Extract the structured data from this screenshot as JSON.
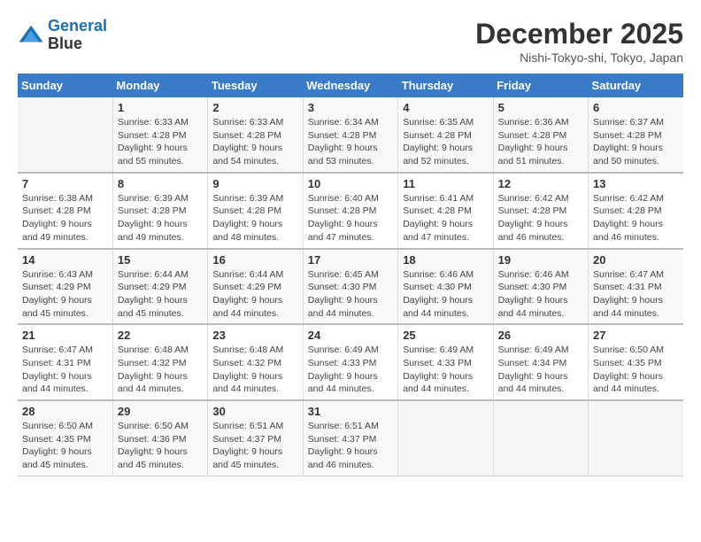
{
  "logo": {
    "line1": "General",
    "line2": "Blue"
  },
  "title": "December 2025",
  "subtitle": "Nishi-Tokyo-shi, Tokyo, Japan",
  "weekdays": [
    "Sunday",
    "Monday",
    "Tuesday",
    "Wednesday",
    "Thursday",
    "Friday",
    "Saturday"
  ],
  "weeks": [
    [
      {
        "day": "",
        "sunrise": "",
        "sunset": "",
        "daylight": ""
      },
      {
        "day": "1",
        "sunrise": "Sunrise: 6:33 AM",
        "sunset": "Sunset: 4:28 PM",
        "daylight": "Daylight: 9 hours and 55 minutes."
      },
      {
        "day": "2",
        "sunrise": "Sunrise: 6:33 AM",
        "sunset": "Sunset: 4:28 PM",
        "daylight": "Daylight: 9 hours and 54 minutes."
      },
      {
        "day": "3",
        "sunrise": "Sunrise: 6:34 AM",
        "sunset": "Sunset: 4:28 PM",
        "daylight": "Daylight: 9 hours and 53 minutes."
      },
      {
        "day": "4",
        "sunrise": "Sunrise: 6:35 AM",
        "sunset": "Sunset: 4:28 PM",
        "daylight": "Daylight: 9 hours and 52 minutes."
      },
      {
        "day": "5",
        "sunrise": "Sunrise: 6:36 AM",
        "sunset": "Sunset: 4:28 PM",
        "daylight": "Daylight: 9 hours and 51 minutes."
      },
      {
        "day": "6",
        "sunrise": "Sunrise: 6:37 AM",
        "sunset": "Sunset: 4:28 PM",
        "daylight": "Daylight: 9 hours and 50 minutes."
      }
    ],
    [
      {
        "day": "7",
        "sunrise": "Sunrise: 6:38 AM",
        "sunset": "Sunset: 4:28 PM",
        "daylight": "Daylight: 9 hours and 49 minutes."
      },
      {
        "day": "8",
        "sunrise": "Sunrise: 6:39 AM",
        "sunset": "Sunset: 4:28 PM",
        "daylight": "Daylight: 9 hours and 49 minutes."
      },
      {
        "day": "9",
        "sunrise": "Sunrise: 6:39 AM",
        "sunset": "Sunset: 4:28 PM",
        "daylight": "Daylight: 9 hours and 48 minutes."
      },
      {
        "day": "10",
        "sunrise": "Sunrise: 6:40 AM",
        "sunset": "Sunset: 4:28 PM",
        "daylight": "Daylight: 9 hours and 47 minutes."
      },
      {
        "day": "11",
        "sunrise": "Sunrise: 6:41 AM",
        "sunset": "Sunset: 4:28 PM",
        "daylight": "Daylight: 9 hours and 47 minutes."
      },
      {
        "day": "12",
        "sunrise": "Sunrise: 6:42 AM",
        "sunset": "Sunset: 4:28 PM",
        "daylight": "Daylight: 9 hours and 46 minutes."
      },
      {
        "day": "13",
        "sunrise": "Sunrise: 6:42 AM",
        "sunset": "Sunset: 4:28 PM",
        "daylight": "Daylight: 9 hours and 46 minutes."
      }
    ],
    [
      {
        "day": "14",
        "sunrise": "Sunrise: 6:43 AM",
        "sunset": "Sunset: 4:29 PM",
        "daylight": "Daylight: 9 hours and 45 minutes."
      },
      {
        "day": "15",
        "sunrise": "Sunrise: 6:44 AM",
        "sunset": "Sunset: 4:29 PM",
        "daylight": "Daylight: 9 hours and 45 minutes."
      },
      {
        "day": "16",
        "sunrise": "Sunrise: 6:44 AM",
        "sunset": "Sunset: 4:29 PM",
        "daylight": "Daylight: 9 hours and 44 minutes."
      },
      {
        "day": "17",
        "sunrise": "Sunrise: 6:45 AM",
        "sunset": "Sunset: 4:30 PM",
        "daylight": "Daylight: 9 hours and 44 minutes."
      },
      {
        "day": "18",
        "sunrise": "Sunrise: 6:46 AM",
        "sunset": "Sunset: 4:30 PM",
        "daylight": "Daylight: 9 hours and 44 minutes."
      },
      {
        "day": "19",
        "sunrise": "Sunrise: 6:46 AM",
        "sunset": "Sunset: 4:30 PM",
        "daylight": "Daylight: 9 hours and 44 minutes."
      },
      {
        "day": "20",
        "sunrise": "Sunrise: 6:47 AM",
        "sunset": "Sunset: 4:31 PM",
        "daylight": "Daylight: 9 hours and 44 minutes."
      }
    ],
    [
      {
        "day": "21",
        "sunrise": "Sunrise: 6:47 AM",
        "sunset": "Sunset: 4:31 PM",
        "daylight": "Daylight: 9 hours and 44 minutes."
      },
      {
        "day": "22",
        "sunrise": "Sunrise: 6:48 AM",
        "sunset": "Sunset: 4:32 PM",
        "daylight": "Daylight: 9 hours and 44 minutes."
      },
      {
        "day": "23",
        "sunrise": "Sunrise: 6:48 AM",
        "sunset": "Sunset: 4:32 PM",
        "daylight": "Daylight: 9 hours and 44 minutes."
      },
      {
        "day": "24",
        "sunrise": "Sunrise: 6:49 AM",
        "sunset": "Sunset: 4:33 PM",
        "daylight": "Daylight: 9 hours and 44 minutes."
      },
      {
        "day": "25",
        "sunrise": "Sunrise: 6:49 AM",
        "sunset": "Sunset: 4:33 PM",
        "daylight": "Daylight: 9 hours and 44 minutes."
      },
      {
        "day": "26",
        "sunrise": "Sunrise: 6:49 AM",
        "sunset": "Sunset: 4:34 PM",
        "daylight": "Daylight: 9 hours and 44 minutes."
      },
      {
        "day": "27",
        "sunrise": "Sunrise: 6:50 AM",
        "sunset": "Sunset: 4:35 PM",
        "daylight": "Daylight: 9 hours and 44 minutes."
      }
    ],
    [
      {
        "day": "28",
        "sunrise": "Sunrise: 6:50 AM",
        "sunset": "Sunset: 4:35 PM",
        "daylight": "Daylight: 9 hours and 45 minutes."
      },
      {
        "day": "29",
        "sunrise": "Sunrise: 6:50 AM",
        "sunset": "Sunset: 4:36 PM",
        "daylight": "Daylight: 9 hours and 45 minutes."
      },
      {
        "day": "30",
        "sunrise": "Sunrise: 6:51 AM",
        "sunset": "Sunset: 4:37 PM",
        "daylight": "Daylight: 9 hours and 45 minutes."
      },
      {
        "day": "31",
        "sunrise": "Sunrise: 6:51 AM",
        "sunset": "Sunset: 4:37 PM",
        "daylight": "Daylight: 9 hours and 46 minutes."
      },
      {
        "day": "",
        "sunrise": "",
        "sunset": "",
        "daylight": ""
      },
      {
        "day": "",
        "sunrise": "",
        "sunset": "",
        "daylight": ""
      },
      {
        "day": "",
        "sunrise": "",
        "sunset": "",
        "daylight": ""
      }
    ]
  ]
}
